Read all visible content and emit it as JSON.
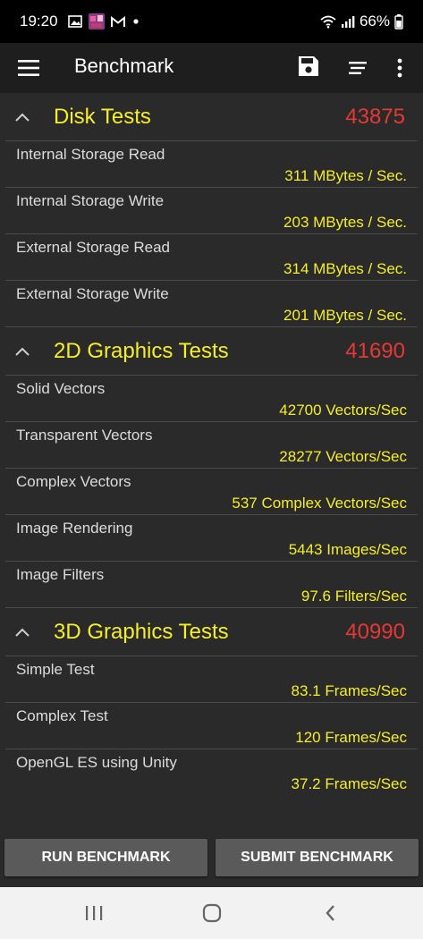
{
  "status_bar": {
    "time": "19:20",
    "battery": "66%",
    "icons": [
      "gallery-icon",
      "app-thumbnail-icon",
      "gmail-icon",
      "dot-icon",
      "wifi-icon",
      "signal-icon",
      "battery-icon"
    ]
  },
  "app_bar": {
    "title": "Benchmark",
    "icons": [
      "menu-icon",
      "save-icon",
      "sort-icon",
      "more-vert-icon"
    ]
  },
  "sections": [
    {
      "title": "Disk Tests",
      "score": "43875",
      "rows": [
        {
          "label": "Internal Storage Read",
          "value": "311 MBytes / Sec."
        },
        {
          "label": "Internal Storage Write",
          "value": "203 MBytes / Sec."
        },
        {
          "label": "External Storage Read",
          "value": "314 MBytes / Sec."
        },
        {
          "label": "External Storage Write",
          "value": "201 MBytes / Sec."
        }
      ]
    },
    {
      "title": "2D Graphics Tests",
      "score": "41690",
      "rows": [
        {
          "label": "Solid Vectors",
          "value": "42700 Vectors/Sec"
        },
        {
          "label": "Transparent Vectors",
          "value": "28277 Vectors/Sec"
        },
        {
          "label": "Complex Vectors",
          "value": "537 Complex Vectors/Sec"
        },
        {
          "label": "Image Rendering",
          "value": "5443 Images/Sec"
        },
        {
          "label": "Image Filters",
          "value": "97.6 Filters/Sec"
        }
      ]
    },
    {
      "title": "3D Graphics Tests",
      "score": "40990",
      "rows": [
        {
          "label": "Simple Test",
          "value": "83.1 Frames/Sec"
        },
        {
          "label": "Complex Test",
          "value": "120 Frames/Sec"
        },
        {
          "label": "OpenGL ES using Unity",
          "value": "37.2 Frames/Sec"
        }
      ]
    }
  ],
  "buttons": {
    "run": "RUN BENCHMARK",
    "submit": "SUBMIT BENCHMARK"
  },
  "colors": {
    "title_yellow": "#f5ee2b",
    "score_red": "#e53935",
    "background": "#2a2a2a",
    "app_bar": "#1e1e1e"
  }
}
